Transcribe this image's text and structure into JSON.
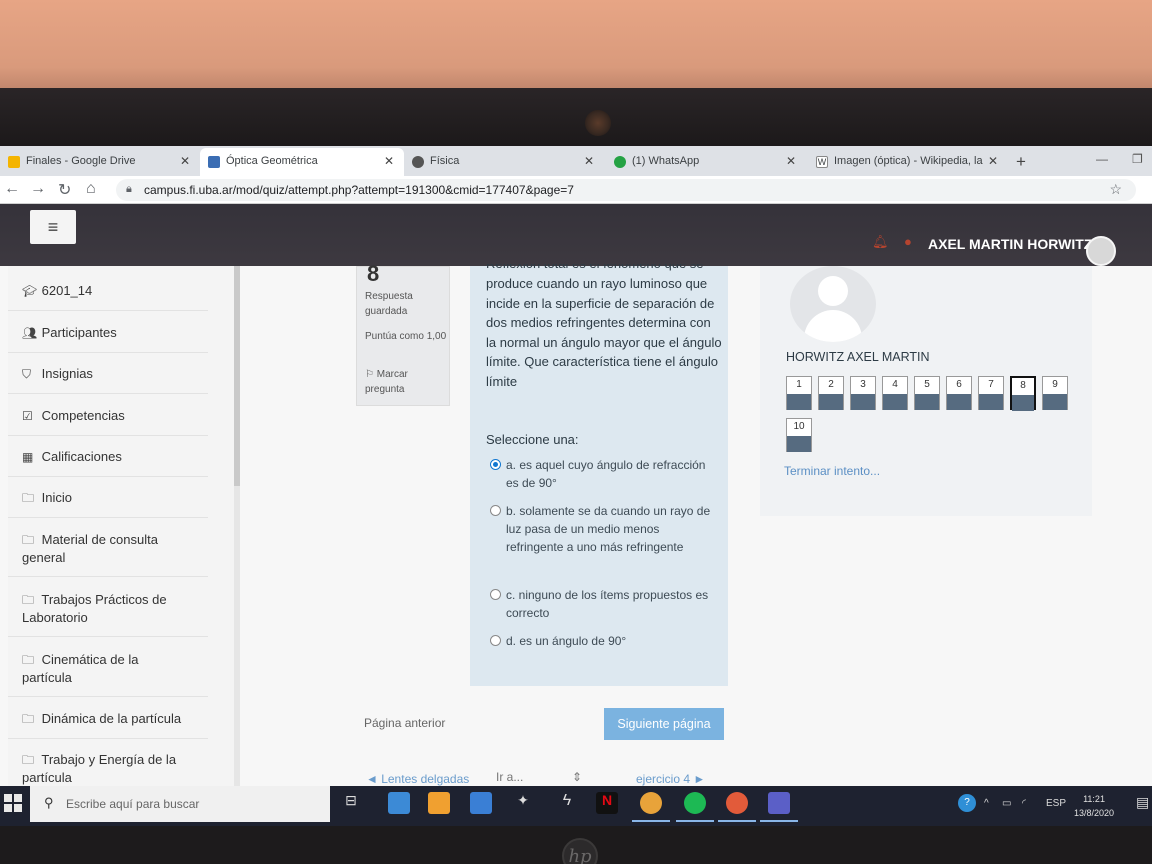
{
  "browser": {
    "tabs": [
      {
        "title": "Finales - Google Drive",
        "active": false
      },
      {
        "title": "Óptica Geométrica",
        "active": true
      },
      {
        "title": "Física",
        "active": false
      },
      {
        "title": "(1) WhatsApp",
        "active": false
      },
      {
        "title": "Imagen (óptica) - Wikipedia, la",
        "active": false
      }
    ],
    "url": "campus.fi.uba.ar/mod/quiz/attempt.php?attempt=191300&cmid=177407&page=7"
  },
  "navbar": {
    "user_name": "AXEL MARTIN HORWITZ"
  },
  "sidebar": {
    "items": [
      {
        "label": "6201_14",
        "icon": "graduation-cap-icon"
      },
      {
        "label": "Participantes",
        "icon": "users-icon"
      },
      {
        "label": "Insignias",
        "icon": "shield-icon"
      },
      {
        "label": "Competencias",
        "icon": "checkbox-icon"
      },
      {
        "label": "Calificaciones",
        "icon": "table-icon"
      },
      {
        "label": "Inicio",
        "icon": "folder-icon"
      },
      {
        "label": "Material de consulta general",
        "icon": "folder-icon"
      },
      {
        "label": "Trabajos Prácticos de Laboratorio",
        "icon": "folder-icon"
      },
      {
        "label": "Cinemática de la partícula",
        "icon": "folder-icon"
      },
      {
        "label": "Dinámica de la partícula",
        "icon": "folder-icon"
      },
      {
        "label": "Trabajo y Energía de la partícula",
        "icon": "folder-icon"
      }
    ]
  },
  "question": {
    "number": "8",
    "status": "Respuesta guardada",
    "score": "Puntúa como 1,00",
    "flag": "Marcar pregunta",
    "text_top": "Reflexión total es el fenómeno que se",
    "text": "produce cuando un rayo luminoso que incide en la superficie de separación de dos medios refringentes determina con la normal un ángulo mayor que el ángulo límite. Que característica tiene el ángulo límite",
    "prompt": "Seleccione una:",
    "answers": [
      {
        "text": "a. es aquel cuyo ángulo de refracción es de 90°",
        "selected": true
      },
      {
        "text": "b. solamente se da cuando un rayo de luz pasa de un medio menos refringente a uno más refringente",
        "selected": false
      },
      {
        "text": "c. ninguno de los ítems propuestos es correcto",
        "selected": false
      },
      {
        "text": "d. es un ángulo de 90°",
        "selected": false
      }
    ]
  },
  "quiz_nav": {
    "name": "HORWITZ AXEL MARTIN",
    "buttons": [
      {
        "label": "1",
        "answered": true
      },
      {
        "label": "2",
        "answered": true
      },
      {
        "label": "3",
        "answered": true
      },
      {
        "label": "4",
        "answered": true
      },
      {
        "label": "5",
        "answered": true
      },
      {
        "label": "6",
        "answered": true
      },
      {
        "label": "7",
        "answered": true
      },
      {
        "label": "8",
        "answered": true,
        "current": true
      },
      {
        "label": "9",
        "answered": true
      },
      {
        "label": "10",
        "answered": true
      }
    ],
    "finish": "Terminar intento..."
  },
  "page_nav": {
    "prev": "Página anterior",
    "next": "Siguiente página",
    "activity_prev": "◄ Lentes delgadas",
    "jump": "Ir a...",
    "activity_next": "ejercicio 4 ►"
  },
  "taskbar": {
    "search_placeholder": "Escribe aquí para buscar",
    "lang": "ESP",
    "time": "11:21",
    "date": "13/8/2020"
  },
  "colors": {
    "navbar": "#3a373e",
    "question_bg": "#dde8f0",
    "accent": "#1177d1",
    "answered_fill": "#566b80",
    "next_button": "#7bb3e0"
  }
}
